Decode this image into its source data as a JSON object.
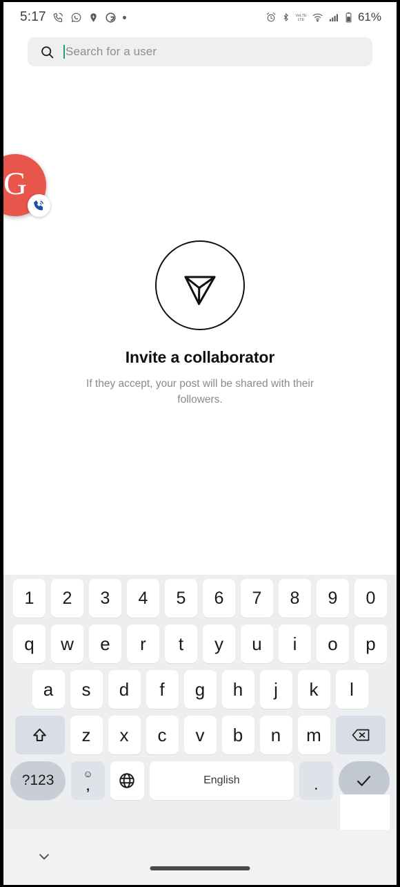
{
  "status_bar": {
    "time": "5:17",
    "battery_percent": "61%",
    "left_icons": [
      "phone-call-icon",
      "whatsapp-icon",
      "location-pin-icon",
      "google-icon",
      "dot-icon"
    ],
    "right_icons": [
      "alarm-icon",
      "bluetooth-icon",
      "volte-icon",
      "wifi-icon",
      "cellular-signal-icon",
      "battery-icon"
    ],
    "volte_label": "VoLTE"
  },
  "search": {
    "placeholder": "Search for a user",
    "value": "",
    "icon": "search-icon",
    "caret_color": "#1a9e7a"
  },
  "floating_bubble": {
    "letter": "G",
    "color": "#e8554b",
    "badge_icon": "phone-call-icon",
    "badge_color": "#1b4fa0"
  },
  "empty_state": {
    "icon": "paper-plane-circle-icon",
    "title": "Invite a collaborator",
    "subtitle": "If they accept, your post will be shared with their followers."
  },
  "keyboard": {
    "row_numbers": [
      "1",
      "2",
      "3",
      "4",
      "5",
      "6",
      "7",
      "8",
      "9",
      "0"
    ],
    "row_q": [
      "q",
      "w",
      "e",
      "r",
      "t",
      "y",
      "u",
      "i",
      "o",
      "p"
    ],
    "row_a": [
      "a",
      "s",
      "d",
      "f",
      "g",
      "h",
      "j",
      "k",
      "l"
    ],
    "row_z": [
      "z",
      "x",
      "c",
      "v",
      "b",
      "n",
      "m"
    ],
    "shift_icon": "shift-up-arrow-icon",
    "backspace_icon": "backspace-icon",
    "symbols_label": "?123",
    "emoji_icon": "emoji-smiley-icon",
    "comma_label": ",",
    "globe_icon": "globe-language-icon",
    "space_label": "English",
    "period_label": ".",
    "enter_icon": "checkmark-icon"
  },
  "nav_bar": {
    "hide_keyboard_icon": "chevron-down-icon",
    "home_indicator": "home-gesture-bar"
  }
}
